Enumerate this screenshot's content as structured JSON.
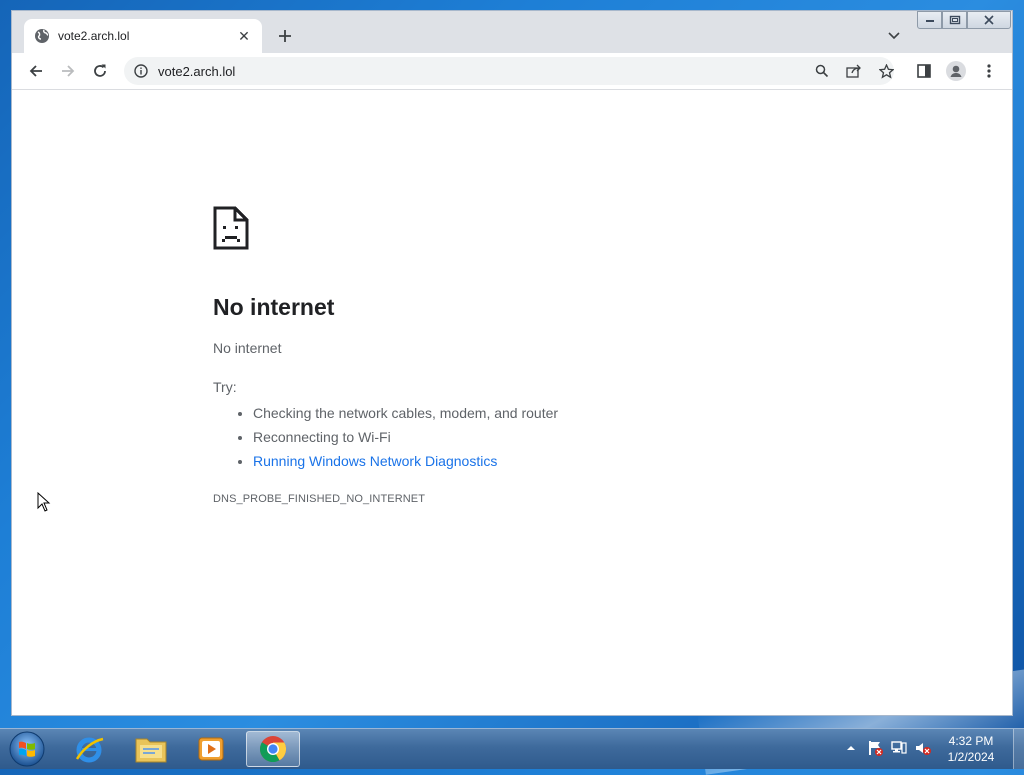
{
  "browser": {
    "tab": {
      "title": "vote2.arch.lol",
      "favicon": "globe-icon"
    },
    "address_bar": {
      "url": "vote2.arch.lol",
      "site_info_icon": "info-icon"
    },
    "toolbar_icons": [
      "back-icon",
      "forward-icon",
      "reload-icon",
      "search-icon",
      "share-icon",
      "star-icon",
      "side-panel-icon",
      "profile-icon",
      "menu-icon"
    ]
  },
  "error_page": {
    "title": "No internet",
    "subtitle": "No internet",
    "try_label": "Try:",
    "suggestions": [
      "Checking the network cables, modem, and router",
      "Reconnecting to Wi-Fi"
    ],
    "diagnostics_link": "Running Windows Network Diagnostics",
    "error_code": "DNS_PROBE_FINISHED_NO_INTERNET"
  },
  "taskbar": {
    "apps": [
      "internet-explorer-icon",
      "file-explorer-icon",
      "media-player-icon",
      "chrome-icon"
    ],
    "active_app": "chrome-icon",
    "clock": {
      "time": "4:32 PM",
      "date": "1/2/2024"
    }
  },
  "colors": {
    "link": "#1a73e8",
    "title_text": "#202124",
    "body_text": "#5f6368",
    "tabstrip_bg": "#dee1e6"
  }
}
